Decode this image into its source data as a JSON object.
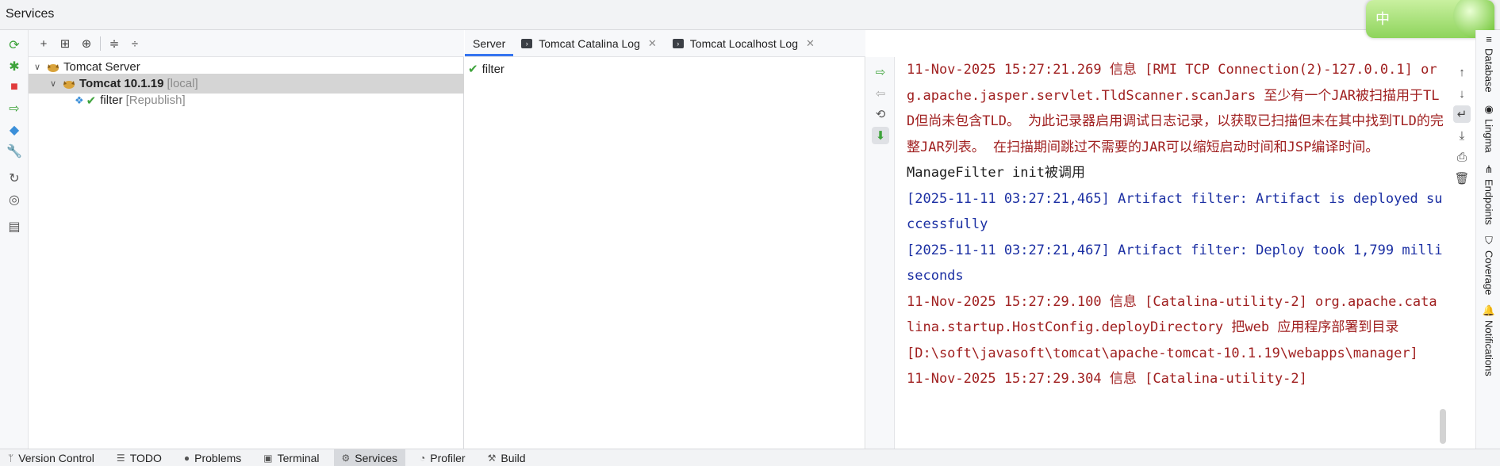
{
  "window": {
    "title": "Services"
  },
  "ime": {
    "text": "中"
  },
  "tree": {
    "server_label": "Tomcat Server",
    "instance_label": "Tomcat 10.1.19",
    "instance_suffix": "[local]",
    "artifact_label": "filter",
    "artifact_suffix": "[Republish]"
  },
  "tabs": [
    {
      "label": "Server"
    },
    {
      "label": "Tomcat Catalina Log"
    },
    {
      "label": "Tomcat Localhost Log"
    }
  ],
  "detail": {
    "deployment": "filter"
  },
  "console": {
    "lines": [
      {
        "text": "11-Nov-2025 15:27:21.269 信息 [RMI TCP Connection(2)-127.0.0.1] org.apache.jasper.servlet.TldScanner.scanJars 至少有一个JAR被扫描用于TLD但尚未包含TLD。 为此记录器启用调试日志记录，以获取已扫描但未在其中找到TLD的完整JAR列表。 在扫描期间跳过不需要的JAR可以缩短启动时间和JSP编译时间。",
        "color": "red"
      },
      {
        "text": "ManageFilter init被调用",
        "color": "black"
      },
      {
        "text": "[2025-11-11 03:27:21,465] Artifact filter: Artifact is deployed successfully",
        "color": "blue"
      },
      {
        "text": "[2025-11-11 03:27:21,467] Artifact filter: Deploy took 1,799 milliseconds",
        "color": "blue"
      },
      {
        "text": "11-Nov-2025 15:27:29.100 信息 [Catalina-utility-2] org.apache.catalina.startup.HostConfig.deployDirectory 把web 应用程序部署到目录 [D:\\soft\\javasoft\\tomcat\\apache-tomcat-10.1.19\\webapps\\manager]",
        "color": "red"
      },
      {
        "text": "11-Nov-2025 15:27:29.304 信息 [Catalina-utility-2]",
        "color": "red"
      }
    ]
  },
  "right_rail": [
    "Database",
    "Lingma",
    "Endpoints",
    "Coverage",
    "Notifications"
  ],
  "bottom_tabs": [
    {
      "label": "Version Control"
    },
    {
      "label": "TODO"
    },
    {
      "label": "Problems"
    },
    {
      "label": "Terminal"
    },
    {
      "label": "Services"
    },
    {
      "label": "Profiler"
    },
    {
      "label": "Build"
    }
  ],
  "colors": {
    "accent": "#3574f0",
    "log_red": "#a02020",
    "log_blue": "#1b2fa3",
    "success": "#3ea33b"
  }
}
